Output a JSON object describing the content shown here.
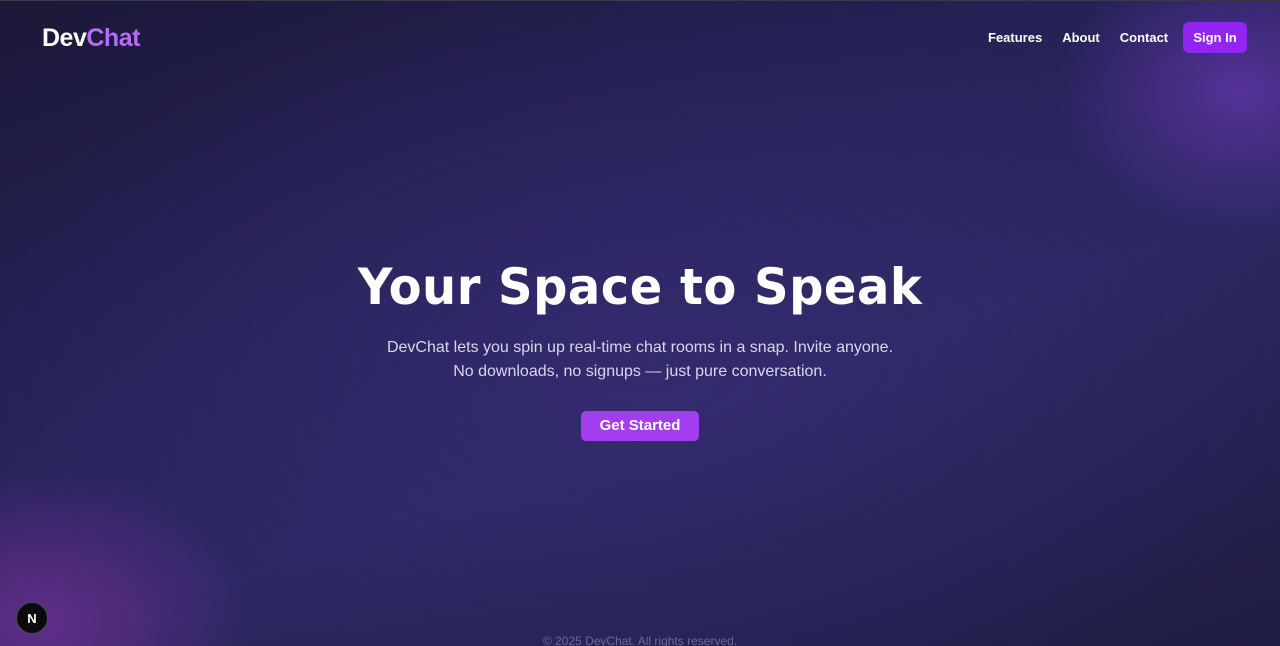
{
  "brand": {
    "part1": "Dev",
    "part2": "Chat"
  },
  "nav": {
    "links": [
      "Features",
      "About",
      "Contact"
    ],
    "signin_label": "Sign In"
  },
  "hero": {
    "title": "Your Space to Speak",
    "subtitle": "DevChat lets you spin up real-time chat rooms in a snap. Invite anyone. No downloads, no signups — just pure conversation.",
    "cta_label": "Get Started"
  },
  "footer": {
    "text": "© 2025 DevChat. All rights reserved."
  },
  "dev_badge": {
    "label": "N",
    "icon": "nextjs-icon"
  },
  "colors": {
    "accent": "#b46cf5",
    "button": "#9226f0",
    "cta": "#a43cf0"
  }
}
